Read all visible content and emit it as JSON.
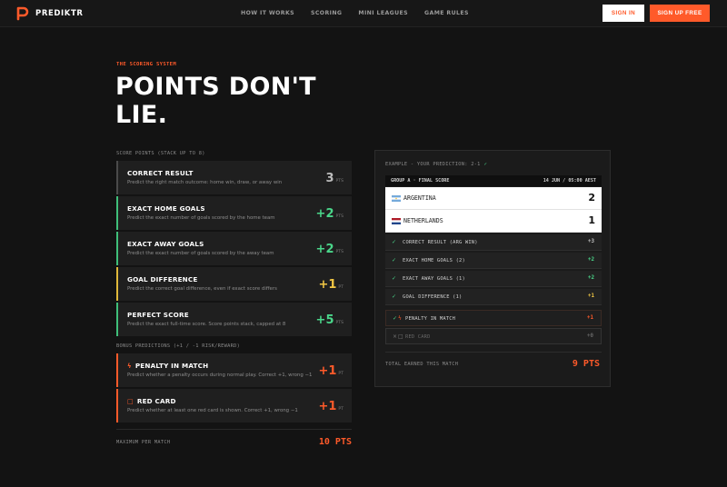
{
  "nav": {
    "logo_text": "PREDIKTR",
    "links": [
      "HOW IT WORKS",
      "SCORING",
      "MINI LEAGUES",
      "GAME RULES"
    ],
    "signin_label": "SIGN IN",
    "signup_label": "SIGN UP FREE"
  },
  "hero": {
    "eyebrow": "THE SCORING SYSTEM",
    "headline": "POINTS DON'T LIE."
  },
  "score_section_label": "SCORE POINTS (STACK UP TO 8)",
  "score_cards": [
    {
      "title": "CORRECT RESULT",
      "desc": "Predict the right match outcome: home win, draw, or away win",
      "value": "3",
      "unit": "PTS",
      "color": "#bdbdbd",
      "border": "#4a4a4a"
    },
    {
      "title": "EXACT HOME GOALS",
      "desc": "Predict the exact number of goals scored by the home team",
      "value": "+2",
      "unit": "PTS",
      "color": "#4ad68a",
      "border": "#3fbf7a"
    },
    {
      "title": "EXACT AWAY GOALS",
      "desc": "Predict the exact number of goals scored by the away team",
      "value": "+2",
      "unit": "PTS",
      "color": "#4ad68a",
      "border": "#3fbf7a"
    },
    {
      "title": "GOAL DIFFERENCE",
      "desc": "Predict the correct goal difference, even if exact score differs",
      "value": "+1",
      "unit": "PT",
      "color": "#f2c744",
      "border": "#e0b83a"
    },
    {
      "title": "PERFECT SCORE",
      "desc": "Predict the exact full-time score. Score points stack, capped at 8",
      "value": "+5",
      "unit": "PTS",
      "color": "#4ad68a",
      "border": "#3fbf7a"
    }
  ],
  "bonus_section_label": "BONUS PREDICTIONS (+1 / -1 RISK/REWARD)",
  "bonus_cards": [
    {
      "icon": "ϟ",
      "title": "PENALTY IN MATCH",
      "desc": "Predict whether a penalty occurs during normal play. Correct +1, wrong −1",
      "value": "+1",
      "unit": "PT",
      "color": "#ff5a2a",
      "border": "#ff5a2a"
    },
    {
      "icon": "□",
      "title": "RED CARD",
      "desc": "Predict whether at least one red card is shown. Correct +1, wrong −1",
      "value": "+1",
      "unit": "PT",
      "color": "#ff5a2a",
      "border": "#ff5a2a"
    }
  ],
  "max": {
    "label": "MAXIMUM PER MATCH",
    "value": "10 PTS"
  },
  "example": {
    "label": "EXAMPLE - YOUR PREDICTION: 2-1",
    "check": "✓",
    "match_left": "GROUP A · FINAL SCORE",
    "match_right": "14 JUN / 05:00 AEST",
    "teams": [
      {
        "name": "ARGENTINA",
        "score": "2"
      },
      {
        "name": "NETHERLANDS",
        "score": "1"
      }
    ],
    "results": [
      {
        "icon": "✓",
        "label": "CORRECT RESULT (ARG WIN)",
        "pts": "+3",
        "color": "#bdbdbd"
      },
      {
        "icon": "✓",
        "label": "EXACT HOME GOALS (2)",
        "pts": "+2",
        "color": "#4ad68a"
      },
      {
        "icon": "✓",
        "label": "EXACT AWAY GOALS (1)",
        "pts": "+2",
        "color": "#4ad68a"
      },
      {
        "icon": "✓",
        "label": "GOAL DIFFERENCE (1)",
        "pts": "+1",
        "color": "#f2c744"
      }
    ],
    "bonus_results": [
      {
        "icon": "✓",
        "sub": "ϟ",
        "label": "PENALTY IN MATCH",
        "pts": "+1",
        "color": "#ff5a2a"
      },
      {
        "icon": "×",
        "sub": "□",
        "label": "RED CARD",
        "pts": "+0",
        "color": "#666666"
      }
    ],
    "total_label": "TOTAL EARNED THIS MATCH",
    "total_value": "9 PTS"
  },
  "colors": {
    "accent": "#ff5a2a",
    "green": "#4ad68a",
    "yellow": "#f2c744"
  }
}
